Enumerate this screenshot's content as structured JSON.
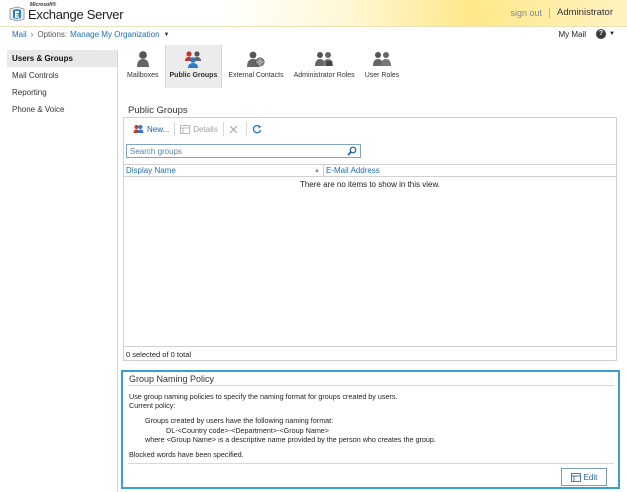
{
  "header": {
    "brand_small": "Microsoft®",
    "brand_name": "Exchange Server",
    "sign_out": "sign out",
    "user": "Administrator"
  },
  "breadcrumb": {
    "mail": "Mail",
    "separator": "›",
    "options_label": "Options:",
    "scope": "Manage My Organization"
  },
  "top_right": {
    "my_mail": "My Mail",
    "help": "?"
  },
  "left_nav": {
    "items": [
      {
        "label": "Users & Groups",
        "active": true
      },
      {
        "label": "Mail Controls",
        "active": false
      },
      {
        "label": "Reporting",
        "active": false
      },
      {
        "label": "Phone & Voice",
        "active": false
      }
    ]
  },
  "tools": [
    {
      "label": "Mailboxes",
      "icon": "single-user-icon",
      "active": false
    },
    {
      "label": "Public Groups",
      "icon": "group-icon",
      "active": true
    },
    {
      "label": "External Contacts",
      "icon": "contact-globe-icon",
      "active": false
    },
    {
      "label": "Administrator Roles",
      "icon": "admin-roles-icon",
      "active": false
    },
    {
      "label": "User Roles",
      "icon": "user-roles-icon",
      "active": false
    }
  ],
  "main": {
    "title": "Public Groups",
    "toolbar": {
      "new_label": "New...",
      "details_label": "Details"
    },
    "search_placeholder": "Search groups",
    "columns": [
      "Display Name",
      "E-Mail Address"
    ],
    "empty_message": "There are no items to show in this view.",
    "status": "0 selected of 0 total"
  },
  "policy": {
    "title": "Group Naming Policy",
    "line1": "Use group naming policies to specify the naming format for groups created by users.",
    "line2": "Current policy:",
    "line3": "Groups created by users have the following naming format:",
    "line4": "DL-<Country code>-<Department>-<Group Name>",
    "line5": "where <Group Name> is a descriptive name provided by the person who creates the group.",
    "line6": "Blocked words have been specified.",
    "edit_label": "Edit"
  },
  "colors": {
    "accent_blue": "#1f6fb5",
    "policy_border": "#3aa0d4"
  }
}
